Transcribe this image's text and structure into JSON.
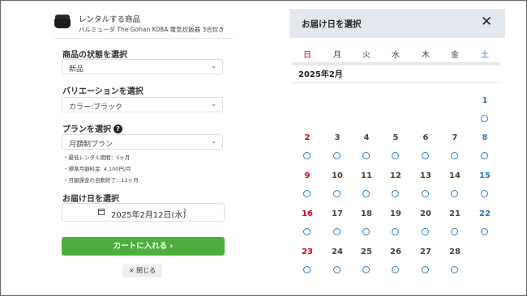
{
  "product": {
    "heading": "レンタルする商品",
    "name": "バルミューダ The Gohan K08A 電気炊飯器 3合炊き"
  },
  "condition": {
    "label": "商品の状態を選択",
    "value": "新品"
  },
  "variation": {
    "label": "バリエーションを選択",
    "value": "カラー:ブラック"
  },
  "plan": {
    "label": "プランを選択",
    "help": "?",
    "value": "月額制プラン",
    "notes": [
      "・最低レンタル期間：3ヶ月",
      "・標準月額料金: 4,100円/月",
      "・月額課金の自動終了：12ヶ月"
    ]
  },
  "delivery": {
    "label": "お届け日を選択",
    "value": "2025年2月12日(水)"
  },
  "cart_label": "カートに入れる ›",
  "close_label": "× 閉じる",
  "calendar": {
    "title": "お届け日を選択",
    "close": "✕",
    "weekdays": [
      "日",
      "月",
      "火",
      "水",
      "木",
      "金",
      "土"
    ],
    "month": "2025年2月",
    "days": [
      1,
      2,
      3,
      4,
      5,
      6,
      7,
      8,
      9,
      10,
      11,
      12,
      13,
      14,
      15,
      16,
      17,
      18,
      19,
      20,
      21,
      22,
      23,
      24,
      25,
      26,
      27,
      28
    ],
    "availability_mark": "○",
    "colors": {
      "sunday": "#d0021b",
      "saturday": "#2c7bbf",
      "available": "#2c7bbf",
      "cart": "#4caf3c"
    }
  }
}
